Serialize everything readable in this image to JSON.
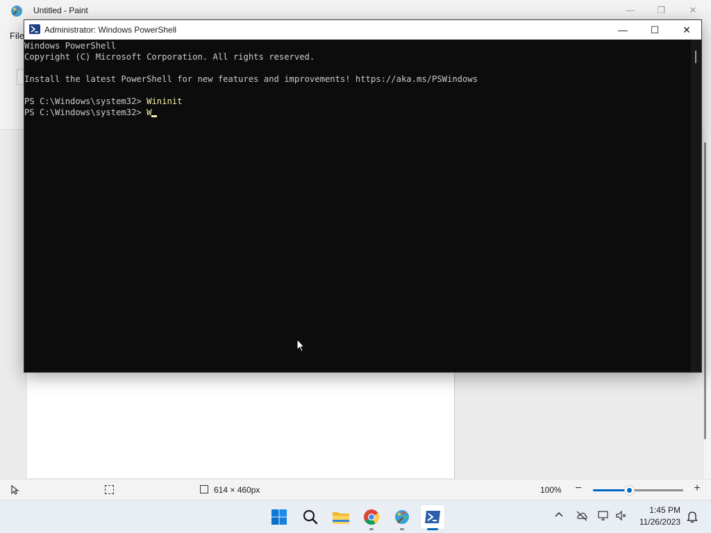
{
  "paint": {
    "window_title": "Untitled - Paint",
    "menu_file": "File",
    "status_canvas_size": "614 × 460px",
    "zoom_label": "100%",
    "zoom_level": 0.4
  },
  "powershell": {
    "window_title": "Administrator: Windows PowerShell",
    "controls": {
      "minimize": "—",
      "maximize": "☐",
      "close": "✕"
    },
    "lines": [
      {
        "text": "Windows PowerShell"
      },
      {
        "text": "Copyright (C) Microsoft Corporation. All rights reserved."
      },
      {
        "text": ""
      },
      {
        "text": "Install the latest PowerShell for new features and improvements! https://aka.ms/PSWindows"
      },
      {
        "text": ""
      },
      {
        "prompt": "PS C:\\Windows\\system32> ",
        "command": "Wininit"
      },
      {
        "prompt": "PS C:\\Windows\\system32> ",
        "command": "W"
      }
    ]
  },
  "taskbar": {
    "apps": [
      {
        "name": "start",
        "icon": "windows-logo-icon"
      },
      {
        "name": "search",
        "icon": "search-icon"
      },
      {
        "name": "file-explorer",
        "icon": "folder-icon"
      },
      {
        "name": "chrome",
        "icon": "chrome-icon"
      },
      {
        "name": "paint",
        "icon": "paint-icon"
      },
      {
        "name": "powershell",
        "icon": "powershell-icon"
      }
    ],
    "clock": {
      "time": "1:45 PM",
      "date": "11/26/2023"
    }
  },
  "colors": {
    "accent": "#0067c0",
    "console_bg": "#0c0c0c",
    "console_text": "#cccccc",
    "console_command": "#f9f1a5"
  }
}
